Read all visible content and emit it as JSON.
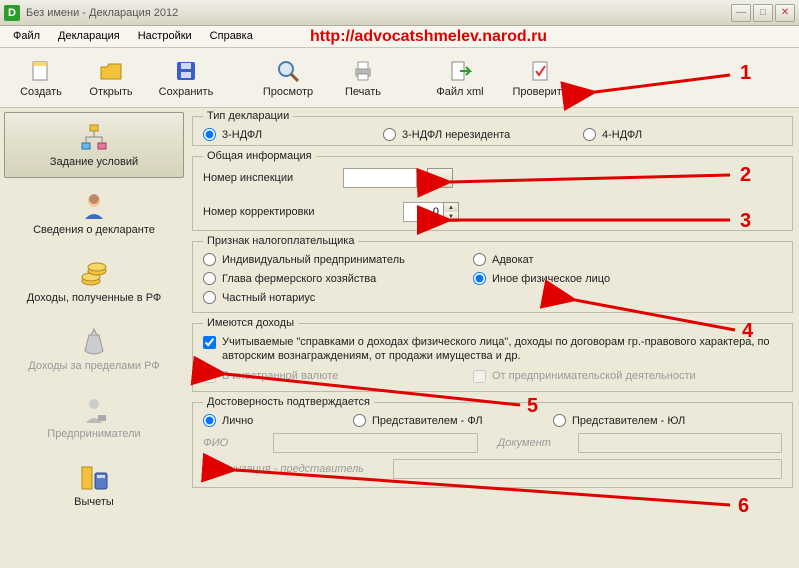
{
  "window": {
    "title": "Без имени - Декларация 2012"
  },
  "menubar": {
    "items": [
      "Файл",
      "Декларация",
      "Настройки",
      "Справка"
    ],
    "url_overlay": "http://advocatshmelev.narod.ru"
  },
  "toolbar": {
    "create": "Создать",
    "open": "Открыть",
    "save": "Сохранить",
    "preview": "Просмотр",
    "print": "Печать",
    "filexml": "Файл xml",
    "check": "Проверить"
  },
  "sidebar": {
    "items": [
      {
        "label": "Задание условий",
        "selected": true
      },
      {
        "label": "Сведения о декларанте",
        "selected": false
      },
      {
        "label": "Доходы, полученные в РФ",
        "selected": false
      },
      {
        "label": "Доходы за пределами РФ",
        "selected": false,
        "disabled": true
      },
      {
        "label": "Предприниматели",
        "selected": false,
        "disabled": true
      },
      {
        "label": "Вычеты",
        "selected": false
      }
    ]
  },
  "decl_type": {
    "legend": "Тип декларации",
    "options": {
      "ndfl3": "3-НДФЛ",
      "ndfl3_nr": "3-НДФЛ нерезидента",
      "ndfl4": "4-НДФЛ"
    },
    "selected": "ndfl3"
  },
  "general": {
    "legend": "Общая информация",
    "insp_label": "Номер инспекции",
    "insp_value": "",
    "corr_label": "Номер корректировки",
    "corr_value": "0"
  },
  "taxpayer": {
    "legend": "Признак налогоплательщика",
    "options": {
      "ip": "Индивидуальный предприниматель",
      "farm": "Глава фермерского хозяйства",
      "notary": "Частный нотариус",
      "advocate": "Адвокат",
      "other": "Иное физическое лицо"
    },
    "selected": "other"
  },
  "income": {
    "legend": "Имеются доходы",
    "cert": "Учитываемые \"справками о доходах физического лица\", доходы по договорам гр.-правового характера, по авторским вознаграждениям, от продажи имущества и др.",
    "foreign": "В иностранной валюте",
    "entrepr": "От предпринимательской деятельности",
    "cert_checked": true,
    "foreign_checked": false,
    "entrepr_checked": false
  },
  "confirm": {
    "legend": "Достоверность подтверждается",
    "options": {
      "self": "Лично",
      "rep_fl": "Представителем - ФЛ",
      "rep_ul": "Представителем - ЮЛ"
    },
    "selected": "self",
    "fio_label": "ФИО",
    "doc_label": "Документ",
    "org_label": "Организация - представитель"
  },
  "annotations": [
    "1",
    "2",
    "3",
    "4",
    "5",
    "6"
  ]
}
